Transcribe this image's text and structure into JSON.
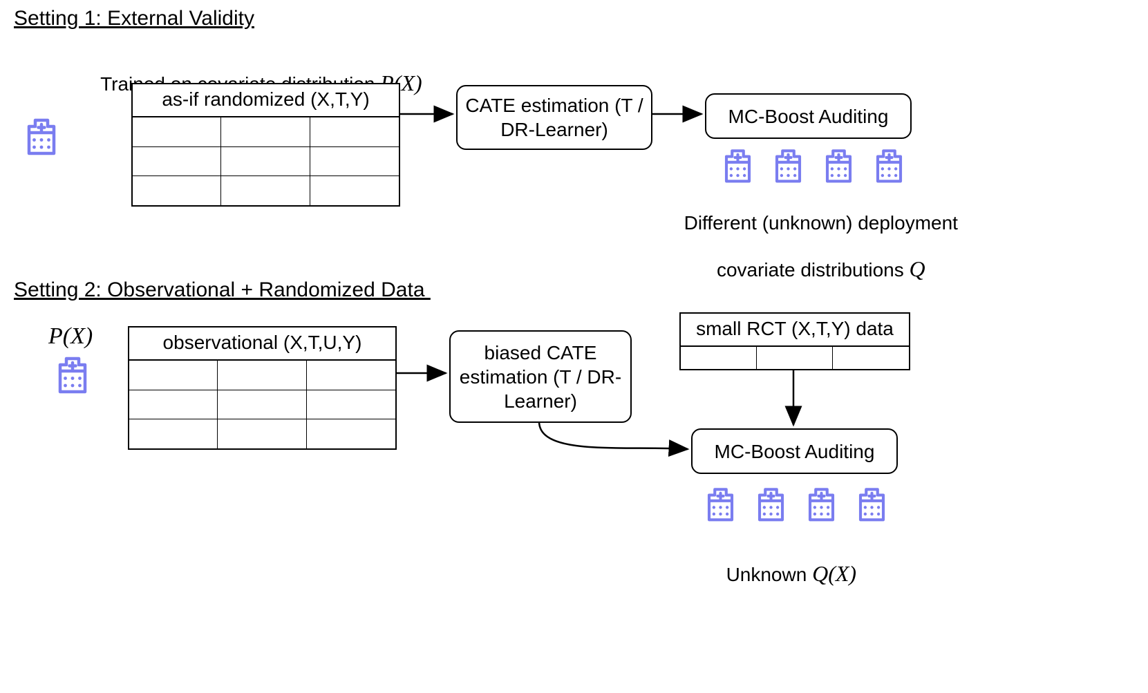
{
  "setting1": {
    "title": "Setting 1: External Validity",
    "caption_top": "Trained on covariate distribution ",
    "caption_top_math": "P(X)",
    "table_header": "as-if randomized (X,T,Y)",
    "box_cate": "CATE estimation\n(T / DR-Learner)",
    "box_audit": "MC-Boost Auditing",
    "dep_line1": "Different (unknown) deployment",
    "dep_line2_pre": "covariate distributions ",
    "dep_line2_math": "Q"
  },
  "setting2": {
    "title": "Setting 2: Observational + Randomized Data ",
    "px_math": "P(X)",
    "table_header": "observational (X,T,U,Y)",
    "box_cate": "biased CATE\nestimation\n(T / DR-Learner)",
    "rct_header": "small RCT (X,T,Y) data",
    "box_audit": "MC-Boost Auditing",
    "unknown_pre": "Unknown ",
    "unknown_math": "Q(X)"
  }
}
